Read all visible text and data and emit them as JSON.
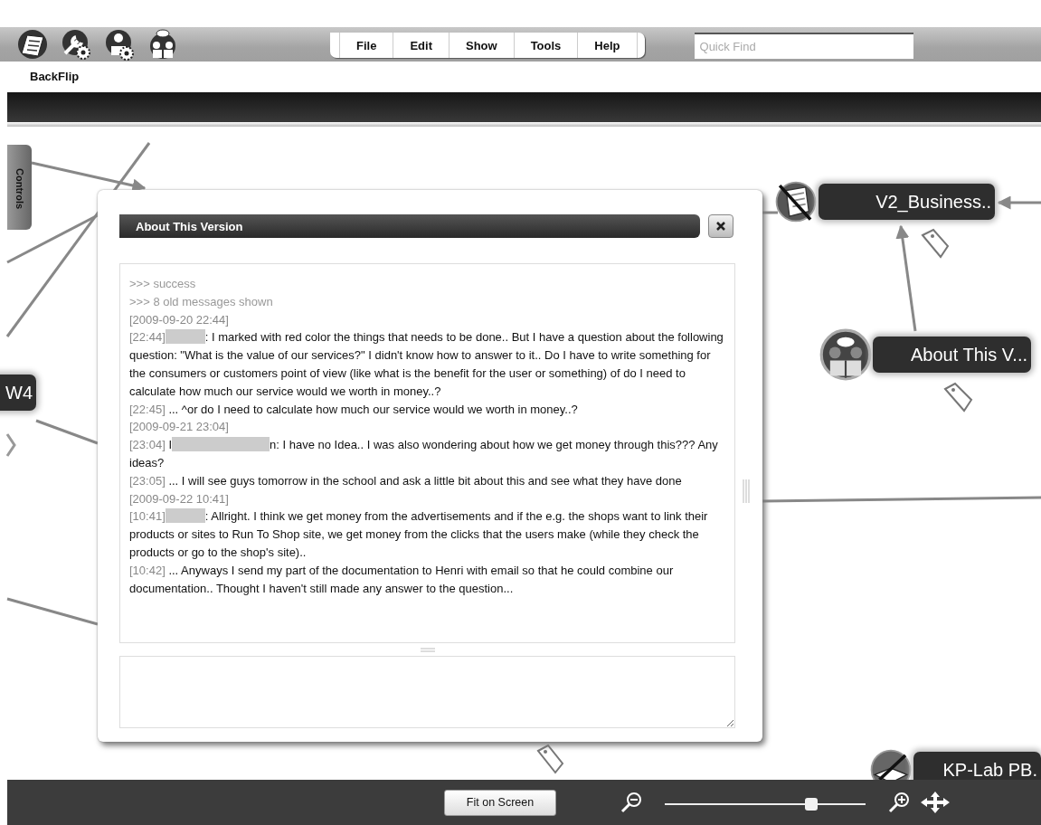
{
  "menu": [
    {
      "label": "File"
    },
    {
      "label": "Edit"
    },
    {
      "label": "Show"
    },
    {
      "label": "Tools"
    },
    {
      "label": "Help"
    }
  ],
  "search": {
    "placeholder": "Quick Find"
  },
  "map_title": "BackFlip",
  "side_tab": "Controls",
  "nodes": [
    {
      "label": "V2_Business..",
      "kind": "document"
    },
    {
      "label": "About This V...",
      "kind": "meeting"
    },
    {
      "label": "W4",
      "kind": "partial"
    },
    {
      "label": "KP-Lab PB.",
      "kind": "wiki"
    }
  ],
  "dialog": {
    "title": "About This Version",
    "log": [
      {
        "kind": "system",
        "text": ">>> success"
      },
      {
        "kind": "system",
        "text": ">>> 8 old messages shown"
      },
      {
        "kind": "date",
        "text": "[2009-09-20 22:44]"
      },
      {
        "kind": "message",
        "time": "[22:44]",
        "redacted": true,
        "text": ": I marked with red color the things that needs to be done.. But I have a question about the following question: \"What is the value of our services?\" I didn't know how to answer to it.. Do I have to write something for the consumers or customers point of view (like what is the benefit for the user or something) of do I need to calculate how much our service would we worth in money..?"
      },
      {
        "kind": "message",
        "time": "[22:45]",
        "redacted": false,
        "text": " ... ^or do I need to calculate how much our service would we worth in money..?"
      },
      {
        "kind": "date",
        "text": "[2009-09-21 23:04]"
      },
      {
        "kind": "message",
        "time": "[23:04]",
        "redacted": true,
        "name_edges": [
          "I",
          "n"
        ],
        "text": ": I have no Idea.. I was also wondering about how we get money through this??? Any ideas?"
      },
      {
        "kind": "message",
        "time": "[23:05]",
        "redacted": false,
        "text": " ... I will see guys tomorrow in the school and ask a little bit about this and see what they have done"
      },
      {
        "kind": "date",
        "text": "[2009-09-22 10:41]"
      },
      {
        "kind": "message",
        "time": "[10:41]",
        "redacted": true,
        "text": ": Allright. I think we get money from the advertisements and if the e.g. the shops want to link their products or sites to Run To Shop site, we get money from the clicks that the users make (while they check the products or go to the shop's site).."
      },
      {
        "kind": "message",
        "time": "[10:42]",
        "redacted": false,
        "text": " ... Anyways I send my part of the documentation to Henri with email so that he could combine our documentation.. Thought I haven't still made any answer to the question..."
      }
    ]
  },
  "bottom_bar": {
    "fit_button": "Fit on Screen",
    "zoom": {
      "level": 0.73
    }
  }
}
